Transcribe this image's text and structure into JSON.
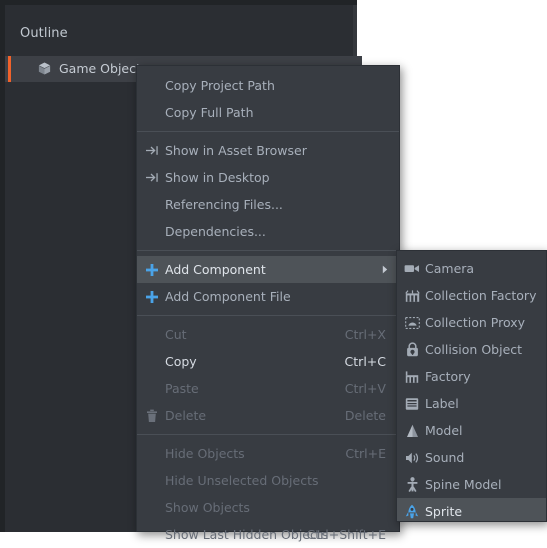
{
  "panel": {
    "title": "Outline",
    "tree": [
      {
        "label": "Game Object",
        "icon": "cube-icon",
        "selected": true
      }
    ]
  },
  "colors": {
    "panel_bg": "#2b2e33",
    "menu_bg": "#383c42",
    "menu_highlight": "#4e5358",
    "accent_orange": "#f0622b",
    "accent_blue": "#4aa3e8",
    "text": "#a8b0bb",
    "text_disabled": "#676d77",
    "text_strong": "#d6dbe2"
  },
  "context_menu": {
    "items": [
      {
        "type": "item",
        "label": "Copy Project Path",
        "shortcut": "",
        "icon": "",
        "state": "normal",
        "name": "copy-project-path"
      },
      {
        "type": "item",
        "label": "Copy Full Path",
        "shortcut": "",
        "icon": "",
        "state": "normal",
        "name": "copy-full-path"
      },
      {
        "type": "separator"
      },
      {
        "type": "item",
        "label": "Show in Asset Browser",
        "shortcut": "",
        "icon": "show-in-icon",
        "state": "normal",
        "name": "show-in-asset-browser"
      },
      {
        "type": "item",
        "label": "Show in Desktop",
        "shortcut": "",
        "icon": "show-in-icon",
        "state": "normal",
        "name": "show-in-desktop"
      },
      {
        "type": "item",
        "label": "Referencing Files...",
        "shortcut": "",
        "icon": "",
        "state": "normal",
        "name": "referencing-files"
      },
      {
        "type": "item",
        "label": "Dependencies...",
        "shortcut": "",
        "icon": "",
        "state": "normal",
        "name": "dependencies"
      },
      {
        "type": "separator"
      },
      {
        "type": "item",
        "label": "Add Component",
        "shortcut": "",
        "icon": "plus-icon",
        "state": "highlighted",
        "submenu": true,
        "name": "add-component"
      },
      {
        "type": "item",
        "label": "Add Component File",
        "shortcut": "",
        "icon": "plus-icon",
        "state": "normal",
        "name": "add-component-file"
      },
      {
        "type": "separator"
      },
      {
        "type": "item",
        "label": "Cut",
        "shortcut": "Ctrl+X",
        "icon": "",
        "state": "disabled",
        "name": "cut"
      },
      {
        "type": "item",
        "label": "Copy",
        "shortcut": "Ctrl+C",
        "icon": "",
        "state": "strong",
        "name": "copy"
      },
      {
        "type": "item",
        "label": "Paste",
        "shortcut": "Ctrl+V",
        "icon": "",
        "state": "disabled",
        "name": "paste"
      },
      {
        "type": "item",
        "label": "Delete",
        "shortcut": "Delete",
        "icon": "trash-icon",
        "state": "disabled",
        "name": "delete"
      },
      {
        "type": "separator"
      },
      {
        "type": "item",
        "label": "Hide Objects",
        "shortcut": "Ctrl+E",
        "icon": "",
        "state": "disabled",
        "name": "hide-objects"
      },
      {
        "type": "item",
        "label": "Hide Unselected Objects",
        "shortcut": "",
        "icon": "",
        "state": "disabled",
        "name": "hide-unselected-objects"
      },
      {
        "type": "item",
        "label": "Show Objects",
        "shortcut": "",
        "icon": "",
        "state": "disabled",
        "name": "show-objects"
      },
      {
        "type": "item",
        "label": "Show Last Hidden Objects",
        "shortcut": "Ctrl+Shift+E",
        "icon": "",
        "state": "disabled",
        "name": "show-last-hidden-objects"
      }
    ]
  },
  "submenu": {
    "items": [
      {
        "label": "Camera",
        "icon": "camera-icon",
        "state": "normal",
        "name": "camera"
      },
      {
        "label": "Collection Factory",
        "icon": "collection-factory-icon",
        "state": "normal",
        "name": "collection-factory"
      },
      {
        "label": "Collection Proxy",
        "icon": "collection-proxy-icon",
        "state": "normal",
        "name": "collection-proxy"
      },
      {
        "label": "Collision Object",
        "icon": "collision-object-icon",
        "state": "normal",
        "name": "collision-object"
      },
      {
        "label": "Factory",
        "icon": "factory-icon",
        "state": "normal",
        "name": "factory"
      },
      {
        "label": "Label",
        "icon": "label-icon",
        "state": "normal",
        "name": "label"
      },
      {
        "label": "Model",
        "icon": "model-icon",
        "state": "normal",
        "name": "model"
      },
      {
        "label": "Sound",
        "icon": "sound-icon",
        "state": "normal",
        "name": "sound"
      },
      {
        "label": "Spine Model",
        "icon": "spine-model-icon",
        "state": "normal",
        "name": "spine-model"
      },
      {
        "label": "Sprite",
        "icon": "sprite-icon",
        "state": "highlighted",
        "name": "sprite"
      }
    ]
  }
}
